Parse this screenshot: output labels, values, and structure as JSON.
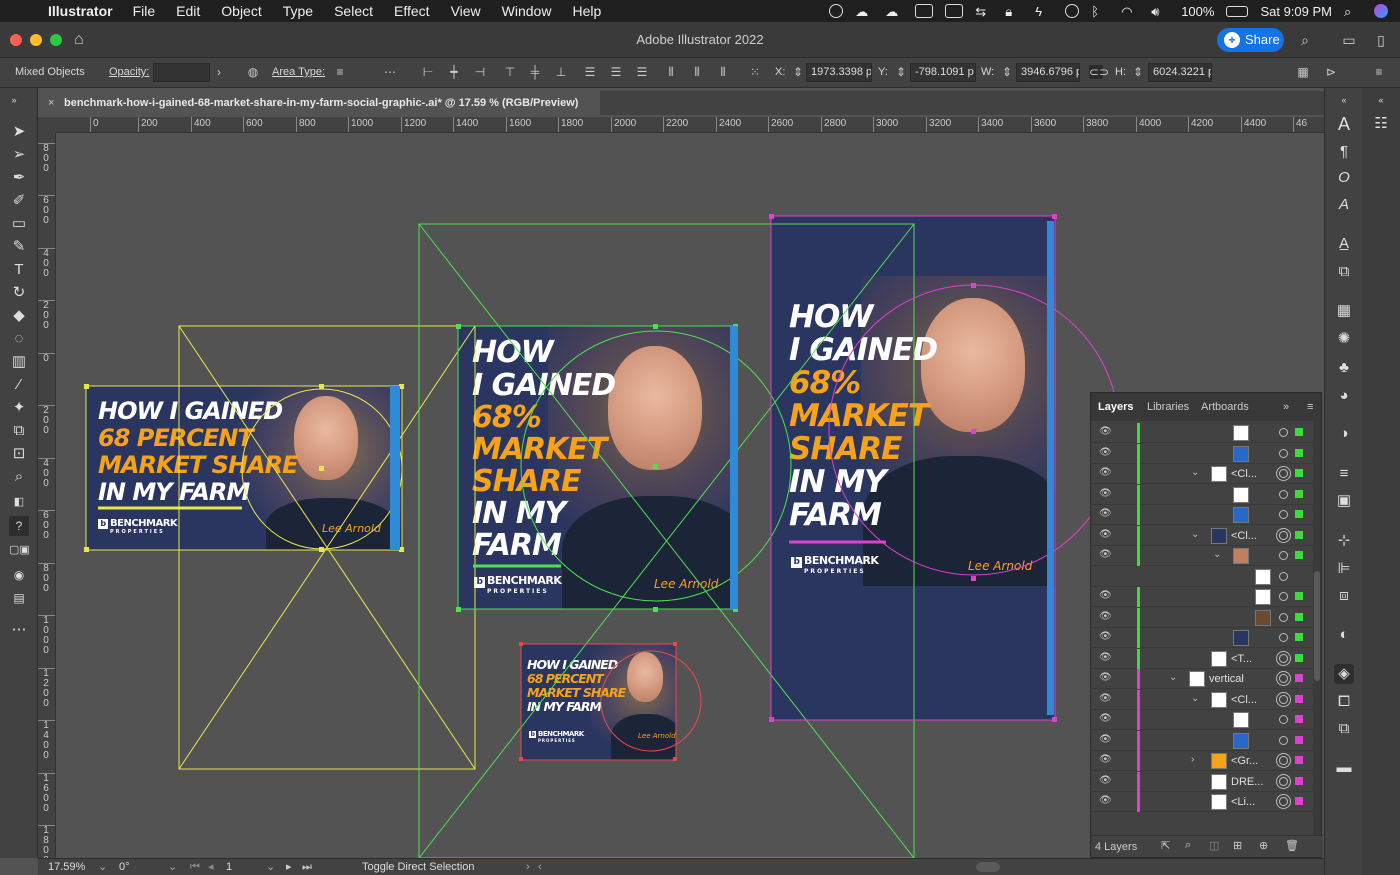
{
  "menubar": {
    "app_name": "Illustrator",
    "items": [
      "File",
      "Edit",
      "Object",
      "Type",
      "Select",
      "Effect",
      "View",
      "Window",
      "Help"
    ],
    "battery": "100%",
    "clock": "Sat 9:09 PM"
  },
  "window": {
    "title": "Adobe Illustrator 2022",
    "share_label": "Share"
  },
  "control": {
    "selection": "Mixed Objects",
    "opacity_label": "Opacity:",
    "opacity_value": "",
    "area_type_label": "Area Type:",
    "x_label": "X:",
    "x_value": "1973.3398 p",
    "y_label": "Y:",
    "y_value": "-798.1091 p",
    "w_label": "W:",
    "w_value": "3946.6796 p",
    "h_label": "H:",
    "h_value": "6024.3221 p"
  },
  "document": {
    "tab_title": "benchmark-how-i-gained-68-market-share-in-my-farm-social-graphic-.ai* @ 17.59 % (RGB/Preview)",
    "close": "×"
  },
  "ruler": {
    "h_marks": [
      "0",
      "200",
      "400",
      "600",
      "800",
      "1000",
      "1200",
      "1400",
      "1600",
      "1800",
      "2000",
      "2200",
      "2400",
      "2600",
      "2800",
      "3000",
      "3200",
      "3400",
      "3600",
      "3800",
      "4000",
      "4200",
      "4400",
      "46"
    ],
    "v_marks": [
      "800",
      "600",
      "400",
      "200",
      "0",
      "200",
      "400",
      "600",
      "800",
      "1000",
      "1200",
      "1400",
      "1600",
      "1800"
    ]
  },
  "artboards": {
    "landscape": {
      "lines": [
        "HOW I GAINED",
        "68 PERCENT",
        "MARKET SHARE",
        "IN MY FARM"
      ],
      "brand": "BENCHMARK",
      "brand_sub": "PROPERTIES",
      "signature": "Lee Arnold"
    },
    "square": {
      "lines": [
        "HOW",
        "I GAINED",
        "68%",
        "MARKET",
        "SHARE",
        "IN MY",
        "FARM"
      ],
      "brand": "BENCHMARK",
      "brand_sub": "PROPERTIES",
      "signature": "Lee Arnold"
    },
    "small": {
      "lines": [
        "HOW I GAINED",
        "68 PERCENT",
        "MARKET SHARE",
        "IN MY FARM"
      ],
      "brand": "BENCHMARK",
      "brand_sub": "PROPERTIES",
      "signature": "Lee Arnold"
    },
    "vertical": {
      "lines": [
        "HOW",
        "I GAINED",
        "68%",
        "MARKET",
        "SHARE",
        "IN MY",
        "FARM"
      ],
      "brand": "BENCHMARK",
      "brand_sub": "PROPERTIES",
      "signature": "Lee Arnold"
    }
  },
  "layers_panel": {
    "tabs": [
      "Layers",
      "Libraries",
      "Artboards"
    ],
    "rows": [
      {
        "name": "",
        "indent": 2,
        "twirl": "",
        "color": "#3ddc3d"
      },
      {
        "name": "",
        "indent": 2,
        "twirl": "",
        "color": "#3ddc3d"
      },
      {
        "name": "<Cl...",
        "indent": 1,
        "twirl": "⌄",
        "color": "#3ddc3d"
      },
      {
        "name": "",
        "indent": 2,
        "twirl": "",
        "color": "#3ddc3d"
      },
      {
        "name": "",
        "indent": 2,
        "twirl": "",
        "color": "#3ddc3d"
      },
      {
        "name": "<Cl...",
        "indent": 1,
        "twirl": "⌄",
        "color": "#3ddc3d"
      },
      {
        "name": "",
        "indent": 2,
        "twirl": "⌄",
        "color": "#3ddc3d"
      },
      {
        "name": "",
        "indent": 3,
        "twirl": "",
        "color": ""
      },
      {
        "name": "",
        "indent": 3,
        "twirl": "",
        "color": "#3ddc3d"
      },
      {
        "name": "",
        "indent": 3,
        "twirl": "",
        "color": "#3ddc3d"
      },
      {
        "name": "",
        "indent": 2,
        "twirl": "",
        "color": "#3ddc3d"
      },
      {
        "name": "<T...",
        "indent": 1,
        "twirl": "",
        "color": "#3ddc3d"
      },
      {
        "name": "vertical",
        "indent": 0,
        "twirl": "⌄",
        "color": "#e040d0"
      },
      {
        "name": "<Cl...",
        "indent": 1,
        "twirl": "⌄",
        "color": "#e040d0"
      },
      {
        "name": "",
        "indent": 2,
        "twirl": "",
        "color": "#e040d0"
      },
      {
        "name": "",
        "indent": 2,
        "twirl": "",
        "color": "#e040d0"
      },
      {
        "name": "<Gr...",
        "indent": 1,
        "twirl": "›",
        "color": "#e040d0"
      },
      {
        "name": "DRE...",
        "indent": 1,
        "twirl": "",
        "color": "#e040d0"
      },
      {
        "name": "<Li...",
        "indent": 1,
        "twirl": "",
        "color": "#e040d0"
      }
    ],
    "count": "4 Layers"
  },
  "status": {
    "zoom": "17.59%",
    "rotation": "0°",
    "artboard_num": "1",
    "tool_hint": "Toggle Direct Selection"
  },
  "colors": {
    "accent": "#1473e6",
    "artboard_bg": "#2a3560",
    "orange": "#f7a21b",
    "green_layer": "#3ddc3d",
    "magenta_layer": "#e040d0",
    "yellow_layer": "#e8e84a",
    "red_layer": "#e84a4a"
  }
}
